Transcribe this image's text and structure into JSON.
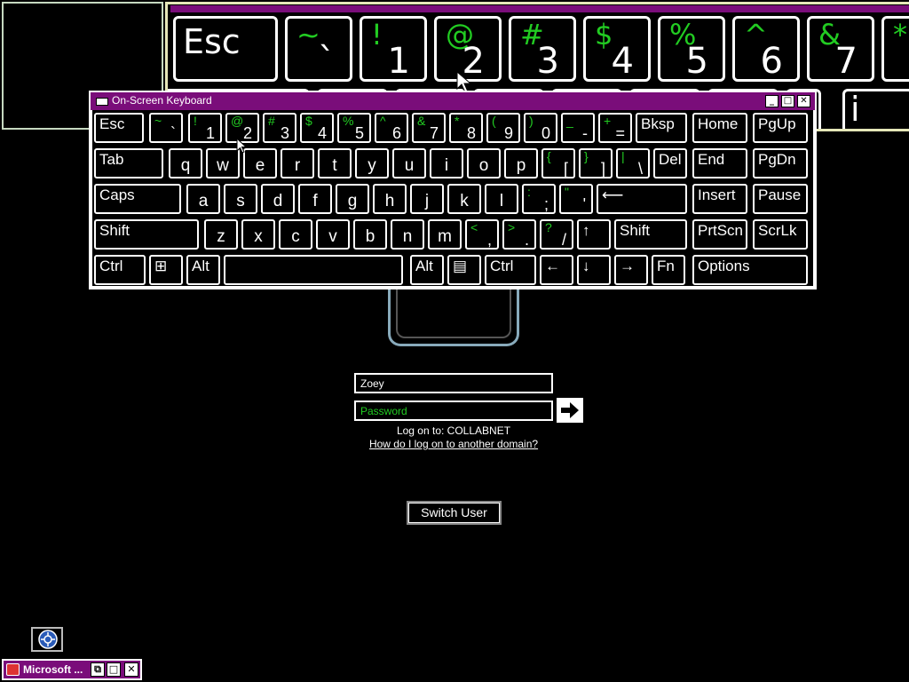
{
  "magnifier": {
    "keys": [
      {
        "word": "Esc"
      },
      {
        "sym": "~",
        "num": "`"
      },
      {
        "sym": "!",
        "num": "1"
      },
      {
        "sym": "@",
        "num": "2"
      },
      {
        "sym": "#",
        "num": "3"
      },
      {
        "sym": "$",
        "num": "4"
      },
      {
        "sym": "%",
        "num": "5"
      },
      {
        "sym": "^",
        "num": "6"
      },
      {
        "sym": "&",
        "num": "7"
      },
      {
        "sym": "*",
        "num": ""
      }
    ],
    "row2_glyph": "i"
  },
  "osk": {
    "title": "On-Screen Keyboard",
    "title_buttons": [
      "_",
      "□",
      "✕"
    ],
    "row1": [
      {
        "label": "Esc"
      },
      {
        "up": "~",
        "dn": "`"
      },
      {
        "up": "!",
        "dn": "1"
      },
      {
        "up": "@",
        "dn": "2"
      },
      {
        "up": "#",
        "dn": "3"
      },
      {
        "up": "$",
        "dn": "4"
      },
      {
        "up": "%",
        "dn": "5"
      },
      {
        "up": "^",
        "dn": "6"
      },
      {
        "up": "&",
        "dn": "7"
      },
      {
        "up": "*",
        "dn": "8"
      },
      {
        "up": "(",
        "dn": "9"
      },
      {
        "up": ")",
        "dn": "0"
      },
      {
        "up": "_",
        "dn": "-"
      },
      {
        "up": "+",
        "dn": "="
      },
      {
        "label": "Bksp"
      },
      {
        "label": "Home"
      },
      {
        "label": "PgUp"
      }
    ],
    "row2": [
      {
        "label": "Tab"
      },
      {
        "c": "q"
      },
      {
        "c": "w"
      },
      {
        "c": "e"
      },
      {
        "c": "r"
      },
      {
        "c": "t"
      },
      {
        "c": "y"
      },
      {
        "c": "u"
      },
      {
        "c": "i"
      },
      {
        "c": "o"
      },
      {
        "c": "p"
      },
      {
        "up": "{",
        "dn": "["
      },
      {
        "up": "}",
        "dn": "]"
      },
      {
        "up": "|",
        "dn": "\\"
      },
      {
        "label": "Del"
      },
      {
        "label": "End"
      },
      {
        "label": "PgDn"
      }
    ],
    "row3": [
      {
        "label": "Caps"
      },
      {
        "c": "a"
      },
      {
        "c": "s"
      },
      {
        "c": "d"
      },
      {
        "c": "f"
      },
      {
        "c": "g"
      },
      {
        "c": "h"
      },
      {
        "c": "j"
      },
      {
        "c": "k"
      },
      {
        "c": "l"
      },
      {
        "up": ":",
        "dn": ";"
      },
      {
        "up": "\"",
        "dn": "'"
      },
      {
        "label": "⟵"
      },
      {
        "label": "Insert"
      },
      {
        "label": "Pause"
      }
    ],
    "row4": [
      {
        "label": "Shift"
      },
      {
        "c": "z"
      },
      {
        "c": "x"
      },
      {
        "c": "c"
      },
      {
        "c": "v"
      },
      {
        "c": "b"
      },
      {
        "c": "n"
      },
      {
        "c": "m"
      },
      {
        "up": "<",
        "dn": ","
      },
      {
        "up": ">",
        "dn": "."
      },
      {
        "up": "?",
        "dn": "/"
      },
      {
        "label": "↑"
      },
      {
        "label": "Shift"
      },
      {
        "label": "PrtScn"
      },
      {
        "label": "ScrLk"
      }
    ],
    "row5": [
      {
        "label": "Ctrl"
      },
      {
        "label": "⊞"
      },
      {
        "label": "Alt"
      },
      {
        "label": ""
      },
      {
        "label": "Alt"
      },
      {
        "label": "▤"
      },
      {
        "label": "Ctrl"
      },
      {
        "label": "←"
      },
      {
        "label": "↓"
      },
      {
        "label": "→"
      },
      {
        "label": "Fn"
      },
      {
        "label": "Options"
      }
    ]
  },
  "logon": {
    "username": "Zoey",
    "password_placeholder": "Password",
    "logon_to": "Log on to: COLLABNET",
    "domain_link": "How do I log on to another domain?",
    "switch_user": "Switch User"
  },
  "taskbar": {
    "item_label": "Microsoft ...",
    "buttons": [
      "⧉",
      "□",
      "✕"
    ]
  }
}
